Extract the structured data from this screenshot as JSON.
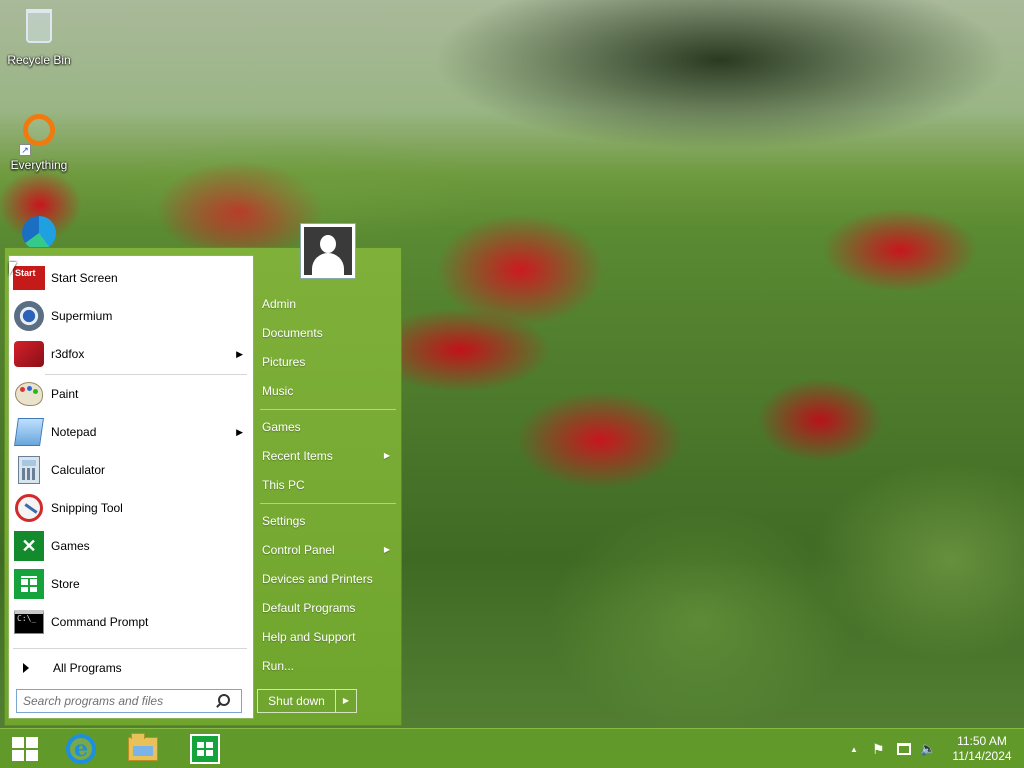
{
  "desktop": {
    "icons": [
      {
        "label": "Recycle Bin"
      },
      {
        "label": "Everything"
      }
    ]
  },
  "start_menu": {
    "programs": [
      {
        "label": "Start Screen",
        "icon": "start-screen-icon"
      },
      {
        "label": "Supermium",
        "icon": "supermium-icon"
      },
      {
        "label": "r3dfox",
        "icon": "r3dfox-icon",
        "has_submenu": true
      },
      {
        "label": "Paint",
        "icon": "paint-icon"
      },
      {
        "label": "Notepad",
        "icon": "notepad-icon",
        "has_submenu": true
      },
      {
        "label": "Calculator",
        "icon": "calculator-icon"
      },
      {
        "label": "Snipping Tool",
        "icon": "snipping-tool-icon"
      },
      {
        "label": "Games",
        "icon": "games-icon"
      },
      {
        "label": "Store",
        "icon": "store-icon"
      },
      {
        "label": "Command Prompt",
        "icon": "command-prompt-icon"
      }
    ],
    "all_programs_label": "All Programs",
    "search_placeholder": "Search programs and files",
    "start_tile_text": "Start",
    "right_items": [
      {
        "label": "Admin"
      },
      {
        "label": "Documents"
      },
      {
        "label": "Pictures"
      },
      {
        "label": "Music"
      },
      {
        "label": "Games"
      },
      {
        "label": "Recent Items",
        "has_submenu": true
      },
      {
        "label": "This PC"
      },
      {
        "label": "Settings"
      },
      {
        "label": "Control Panel",
        "has_submenu": true
      },
      {
        "label": "Devices and Printers"
      },
      {
        "label": "Default Programs"
      },
      {
        "label": "Help and Support"
      },
      {
        "label": "Run..."
      }
    ],
    "shutdown_label": "Shut down",
    "accent": "#6fa52d"
  },
  "taskbar": {
    "pinned": [
      "windows-start-icon",
      "internet-explorer-icon",
      "file-explorer-icon",
      "store-icon"
    ],
    "ie_glyph": "e",
    "tray_icons": [
      "show-hidden-icons-icon",
      "action-center-flag-icon",
      "network-icon",
      "volume-icon"
    ],
    "tray_glyphs": {
      "chevron": "▲",
      "flag": "⚑",
      "volume": "🔈"
    },
    "clock": {
      "time": "11:50 AM",
      "date": "11/14/2024"
    }
  }
}
